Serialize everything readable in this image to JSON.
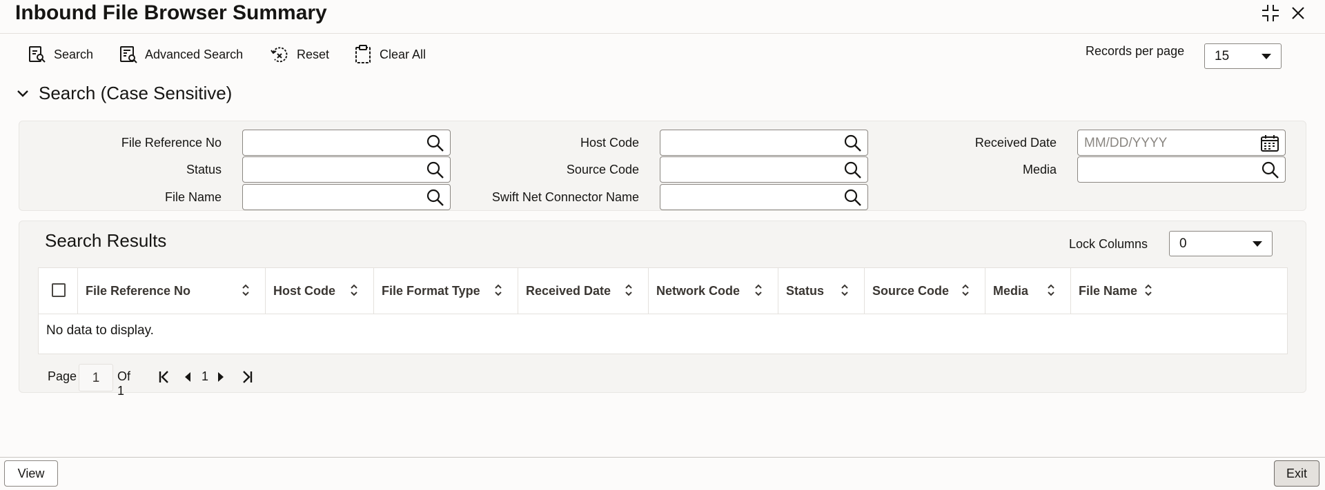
{
  "window": {
    "title": "Inbound File Browser Summary",
    "collapse_icon": "compress-icon",
    "close_icon": "close-icon"
  },
  "toolbar": {
    "search_label": "Search",
    "advanced_search_label": "Advanced Search",
    "reset_label": "Reset",
    "clear_all_label": "Clear All",
    "records_per_page_label": "Records per page",
    "records_per_page_value": "15"
  },
  "search_section": {
    "header": "Search (Case Sensitive)",
    "fields": {
      "file_reference_no": {
        "label": "File Reference No",
        "value": ""
      },
      "status": {
        "label": "Status",
        "value": ""
      },
      "file_name": {
        "label": "File Name",
        "value": ""
      },
      "host_code": {
        "label": "Host Code",
        "value": ""
      },
      "source_code": {
        "label": "Source Code",
        "value": ""
      },
      "swift_net_connector_name": {
        "label": "Swift Net Connector Name",
        "value": ""
      },
      "received_date": {
        "label": "Received Date",
        "value": "",
        "placeholder": "MM/DD/YYYY"
      },
      "media": {
        "label": "Media",
        "value": ""
      }
    }
  },
  "results": {
    "title": "Search Results",
    "lock_columns_label": "Lock Columns",
    "lock_columns_value": "0",
    "columns": [
      "File Reference No",
      "Host Code",
      "File Format Type",
      "Received Date",
      "Network Code",
      "Status",
      "Source Code",
      "Media",
      "File Name"
    ],
    "rows": [],
    "empty_message": "No data to display."
  },
  "pagination": {
    "page_label": "Page",
    "current_page": "1",
    "of_label": "Of 1",
    "page_number": "1"
  },
  "footer": {
    "view_label": "View",
    "exit_label": "Exit"
  },
  "colors": {
    "background": "#fcfbfa",
    "panel": "#f5f4f2",
    "text": "#161513",
    "border": "#8a8681"
  }
}
